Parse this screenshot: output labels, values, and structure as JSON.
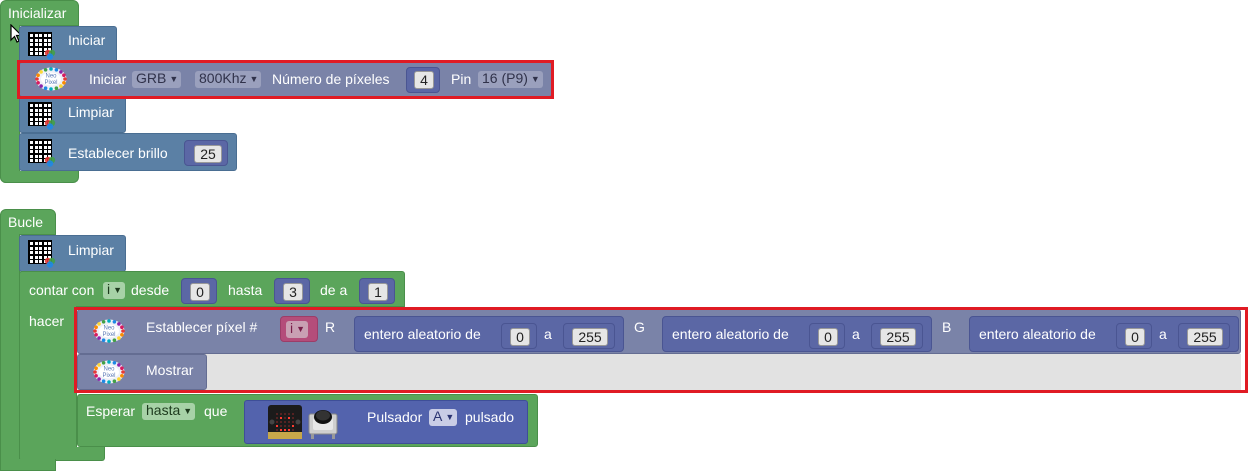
{
  "init": {
    "hat_label": "Inicializar",
    "iniciar_label": "Iniciar",
    "neo_iniciar": {
      "label": "Iniciar",
      "color_order": "GRB",
      "frequency": "800Khz",
      "num_pixels_label": "Número de píxeles",
      "num_pixels": "4",
      "pin_label": "Pin",
      "pin": "16 (P9)"
    },
    "limpiar_label": "Limpiar",
    "brillo_label": "Establecer brillo",
    "brillo_value": "25"
  },
  "loop": {
    "hat_label": "Bucle",
    "limpiar_label": "Limpiar",
    "for": {
      "label": "contar con",
      "var": "i",
      "desde_label": "desde",
      "desde": "0",
      "hasta_label": "hasta",
      "hasta": "3",
      "de_label": "de a",
      "step": "1",
      "do_label": "hacer"
    },
    "set_pixel": {
      "label": "Establecer píxel #",
      "index_var": "i",
      "r_label": "R",
      "g_label": "G",
      "b_label": "B",
      "random_label": "entero aleatorio de",
      "a_label": "a",
      "r_min": "0",
      "r_max": "255",
      "g_min": "0",
      "g_max": "255",
      "b_min": "0",
      "b_max": "255"
    },
    "mostrar_label": "Mostrar",
    "wait": {
      "label": "Esperar",
      "mode": "hasta",
      "que_label": "que",
      "button_label": "Pulsador",
      "button": "A",
      "pressed_label": "pulsado"
    }
  },
  "icons": {
    "matrix": "led-matrix-icon",
    "neopixel": "neopixel-ring-icon",
    "board": "microbit-board-icon",
    "button": "push-button-icon",
    "cursor": "mouse-pointer-icon"
  },
  "colors": {
    "control_green": "#5ba55b",
    "display_blue": "#5b80a5",
    "neopixel_slate": "#7a83a8",
    "math_violet": "#5b67a5",
    "highlight_red": "#e01b24"
  }
}
